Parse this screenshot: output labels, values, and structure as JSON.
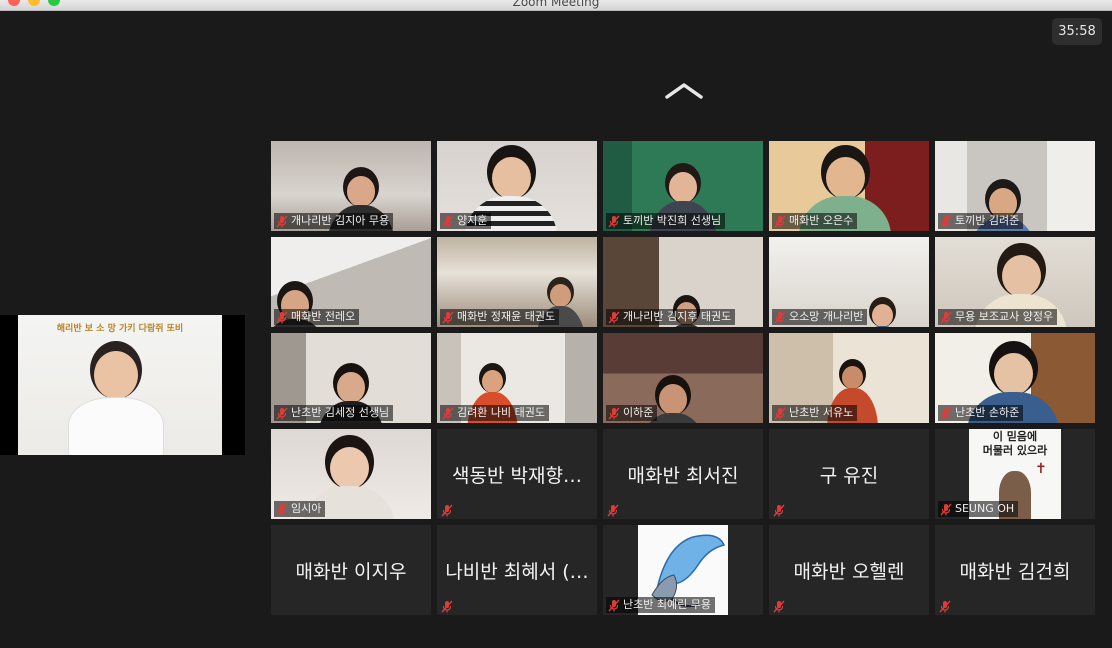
{
  "window": {
    "title": "Zoom Meeting"
  },
  "timer": "35:58",
  "active_speaker": {
    "banner": "해리반 보 소 망 가키 다람쥐 또비"
  },
  "gallery": {
    "tiles": [
      {
        "name": "개나리반 김지아 무용",
        "video": true,
        "muted": true
      },
      {
        "name": "양지훈",
        "video": true,
        "muted": true
      },
      {
        "name": "토끼반 박진희 선생님",
        "video": true,
        "muted": true
      },
      {
        "name": "매화반 오은수",
        "video": true,
        "muted": true
      },
      {
        "name": "토끼반 김려준",
        "video": true,
        "muted": true
      },
      {
        "name": "매화반 전레오",
        "video": true,
        "muted": true
      },
      {
        "name": "매화반 정재윤 태권도",
        "video": true,
        "muted": true
      },
      {
        "name": "개나리반 김지후 태권도",
        "video": true,
        "muted": true
      },
      {
        "name": "오소망 개나리반",
        "video": true,
        "muted": true
      },
      {
        "name": "무용 보조교사 양정우",
        "video": true,
        "muted": true
      },
      {
        "name": "난초반 김세정 선생님",
        "video": true,
        "muted": true
      },
      {
        "name": "김려환 나비 태권도",
        "video": true,
        "muted": true
      },
      {
        "name": "이하준",
        "video": true,
        "muted": true
      },
      {
        "name": "난초반 서유노",
        "video": true,
        "muted": true
      },
      {
        "name": "난초반 손하준",
        "video": true,
        "muted": true
      },
      {
        "name": "임시아",
        "video": true,
        "muted": true
      },
      {
        "name": "색동반 박재향…",
        "video": false,
        "muted": true
      },
      {
        "name": "매화반 최서진",
        "video": false,
        "muted": true
      },
      {
        "name": "구 유진",
        "video": false,
        "muted": true
      },
      {
        "name": "SEUNG OH",
        "video": true,
        "muted": true,
        "poster_text": [
          "이 믿음에",
          "머물러 있으라"
        ]
      },
      {
        "name": "매화반 이지우",
        "video": false,
        "muted": false
      },
      {
        "name": "나비반 최혜서 (…",
        "video": false,
        "muted": true
      },
      {
        "name": "난초반 최예린 무용",
        "video": true,
        "muted": true
      },
      {
        "name": "매화반 오헬렌",
        "video": false,
        "muted": true
      },
      {
        "name": "매화반 김건희",
        "video": false,
        "muted": true
      }
    ]
  }
}
